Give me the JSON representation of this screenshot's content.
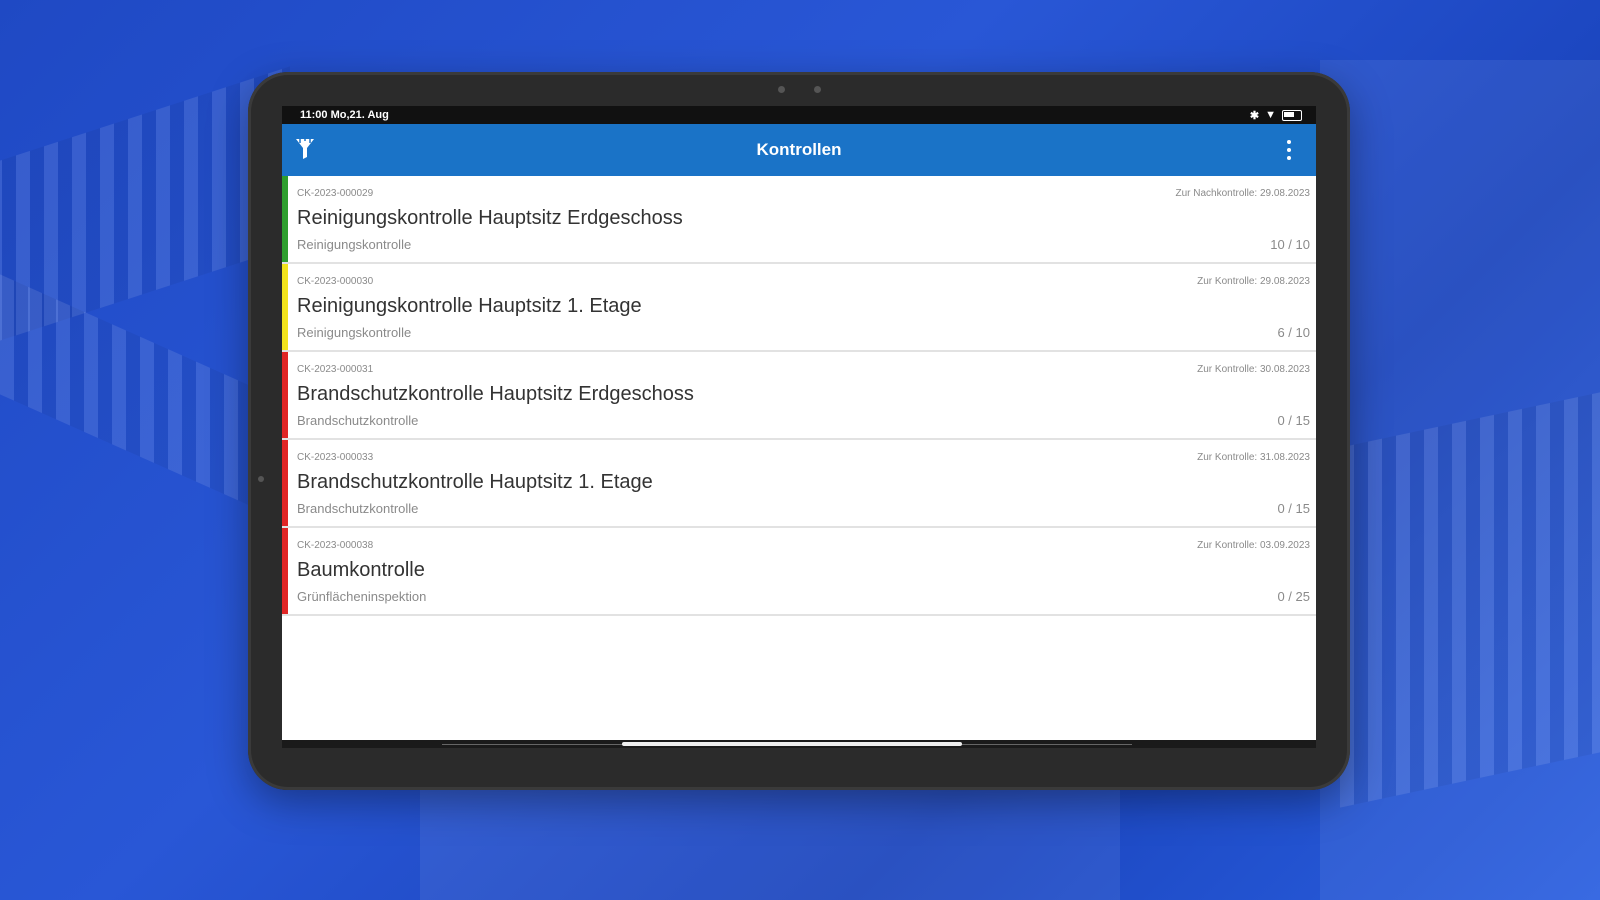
{
  "status_bar": {
    "time_date": "11:00 Mo,21. Aug"
  },
  "app_bar": {
    "title": "Kontrollen",
    "filter_icon": "filter-icon",
    "menu_icon": "more-vert-icon",
    "color": "#1a73c7"
  },
  "items": [
    {
      "code": "CK-2023-000029",
      "due": "Zur Nachkontrolle: 29.08.2023",
      "title": "Reinigungskontrolle Hauptsitz Erdgeschoss",
      "type": "Reinigungskontrolle",
      "progress": "10 / 10",
      "status_color": "#2e9e2e"
    },
    {
      "code": "CK-2023-000030",
      "due": "Zur Kontrolle: 29.08.2023",
      "title": "Reinigungskontrolle Hauptsitz 1. Etage",
      "type": "Reinigungskontrolle",
      "progress": "6 / 10",
      "status_color": "#f2e31c"
    },
    {
      "code": "CK-2023-000031",
      "due": "Zur Kontrolle: 30.08.2023",
      "title": "Brandschutzkontrolle Hauptsitz Erdgeschoss",
      "type": "Brandschutzkontrolle",
      "progress": "0 / 15",
      "status_color": "#e02525"
    },
    {
      "code": "CK-2023-000033",
      "due": "Zur Kontrolle: 31.08.2023",
      "title": "Brandschutzkontrolle Hauptsitz 1. Etage",
      "type": "Brandschutzkontrolle",
      "progress": "0 / 15",
      "status_color": "#e02525"
    },
    {
      "code": "CK-2023-000038",
      "due": "Zur Kontrolle: 03.09.2023",
      "title": "Baumkontrolle",
      "type": "Grünflächeninspektion",
      "progress": "0 / 25",
      "status_color": "#e02525"
    }
  ]
}
